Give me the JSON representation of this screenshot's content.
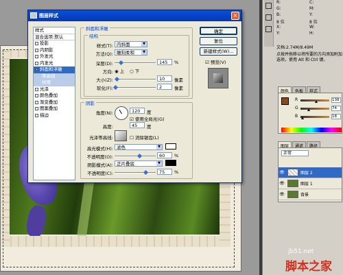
{
  "dialog": {
    "title": "图层样式",
    "list": [
      {
        "label": "样式",
        "type": "header"
      },
      {
        "label": "混合选项:默认",
        "type": "header"
      },
      {
        "label": "投影",
        "type": "check",
        "checked": false
      },
      {
        "label": "内阴影",
        "type": "check",
        "checked": false
      },
      {
        "label": "外发光",
        "type": "check",
        "checked": false
      },
      {
        "label": "内发光",
        "type": "check",
        "checked": false
      },
      {
        "label": "斜面和浮雕",
        "type": "check",
        "checked": true,
        "selected": true
      },
      {
        "label": "等高线",
        "type": "sub"
      },
      {
        "label": "纹理",
        "type": "sub"
      },
      {
        "label": "光泽",
        "type": "check",
        "checked": false
      },
      {
        "label": "颜色叠加",
        "type": "check",
        "checked": false
      },
      {
        "label": "渐变叠加",
        "type": "check",
        "checked": false
      },
      {
        "label": "图案叠加",
        "type": "check",
        "checked": false
      },
      {
        "label": "描边",
        "type": "check",
        "checked": false
      }
    ],
    "bevel": {
      "group_title": "斜面和浮雕",
      "structure_title": "结构",
      "style_label": "样式(T):",
      "style_value": "内斜面",
      "method_label": "方法(Q):",
      "method_value": "雕刻柔和",
      "depth_label": "深度(D):",
      "depth_value": "145",
      "depth_unit": "%",
      "depth_level": 0.15,
      "direction_label": "方向:",
      "direction_up": "上",
      "direction_down": "下",
      "size_label": "大小(Z):",
      "size_value": "10",
      "size_unit": "像素",
      "size_level": 0.05,
      "soften_label": "软化(F):",
      "soften_value": "2",
      "soften_unit": "像素",
      "soften_level": 0.02
    },
    "shading": {
      "group_title": "阴影",
      "angle_label": "角度(N):",
      "angle_value": "120",
      "angle_unit": "度",
      "global_light_label": "使用全局光(G)",
      "altitude_label": "高度:",
      "altitude_value": "45",
      "altitude_unit": "度",
      "gloss_label": "光泽等高线:",
      "antialias_label": "消除锯齿(L)",
      "highlight_mode_label": "高光模式(H):",
      "highlight_mode_value": "滤色",
      "highlight_opacity_label": "不透明度(O):",
      "highlight_opacity_value": "60",
      "highlight_opacity_level": 0.6,
      "shadow_mode_label": "阴影模式(A):",
      "shadow_mode_value": "正片叠底",
      "shadow_opacity_label": "不透明度(C):",
      "shadow_opacity_value": "75",
      "shadow_opacity_level": 0.75,
      "percent": "%"
    },
    "buttons": {
      "ok": "确定",
      "reset": "复位",
      "new_style": "新建样式(W)...",
      "preview": "预览(V)"
    },
    "colors": {
      "highlight": "#ffffff",
      "shadow": "#000000"
    }
  },
  "info_panel": {
    "rows": [
      {
        "k": "R:",
        "k2": "C:"
      },
      {
        "k": "G:",
        "k2": "M:"
      },
      {
        "k": "B:",
        "k2": "Y:"
      },
      {
        "k": "8 位",
        "k2": "8 位"
      },
      {
        "k": "X:",
        "k2": "W:"
      },
      {
        "k": "Y:",
        "k2": "H:"
      }
    ],
    "doc_text": "文档:2.74M/8.49M",
    "help_text": "点按并拖移以将所要的方向添加附加选项，使用 Alt 和 Ctrl 键。"
  },
  "color_panel": {
    "tabs": [
      "颜色",
      "色板",
      "样式"
    ],
    "fg_color": "#8a4a12",
    "sliders": [
      {
        "k": "R",
        "v": "138",
        "level": 0.54
      },
      {
        "k": "G",
        "v": "74",
        "level": 0.29
      },
      {
        "k": "B",
        "v": "18",
        "level": 0.07
      }
    ]
  },
  "layers_panel": {
    "tabs": [
      "图层",
      "通道",
      "路径"
    ],
    "blend_mode": "正常",
    "layers": [
      {
        "name": "图层 2",
        "selected": true
      },
      {
        "name": "图层 1",
        "selected": false
      },
      {
        "name": "背景",
        "selected": false
      }
    ]
  },
  "watermark": {
    "url": "jb51.net",
    "name": "脚本之家"
  }
}
